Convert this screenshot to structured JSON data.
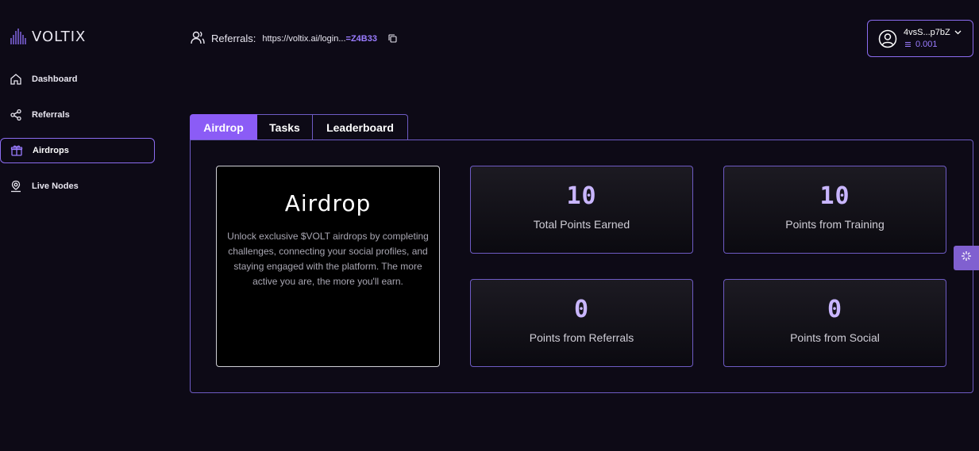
{
  "brand": {
    "name": "VOLTIX"
  },
  "sidebar": {
    "items": [
      {
        "label": "Dashboard",
        "icon": "home-icon",
        "active": false
      },
      {
        "label": "Referrals",
        "icon": "share-icon",
        "active": false
      },
      {
        "label": "Airdrops",
        "icon": "gift-icon",
        "active": true
      },
      {
        "label": "Live Nodes",
        "icon": "location-user-icon",
        "active": false
      }
    ]
  },
  "header": {
    "referral_label": "Referrals:",
    "referral_url": "https://voltix.ai/login...",
    "referral_code": "=Z4B33",
    "account": {
      "address": "4vsS...p7bZ",
      "balance": "0.001"
    }
  },
  "tabs": [
    {
      "label": "Airdrop",
      "active": true
    },
    {
      "label": "Tasks",
      "active": false
    },
    {
      "label": "Leaderboard",
      "active": false
    }
  ],
  "intro": {
    "title": "Airdrop",
    "description": "Unlock exclusive $VOLT airdrops by completing challenges, connecting your social profiles, and staying engaged with the platform. The more active you are, the more you'll earn."
  },
  "stats": [
    {
      "value": "10",
      "label": "Total Points Earned"
    },
    {
      "value": "10",
      "label": "Points from Training"
    },
    {
      "value": "0",
      "label": "Points from Referrals"
    },
    {
      "value": "0",
      "label": "Points from Social"
    }
  ],
  "colors": {
    "accent": "#8b5cf6",
    "accent_text": "#9a7cff",
    "background": "#0d0a16",
    "stat_value": "#c9b6ff"
  }
}
